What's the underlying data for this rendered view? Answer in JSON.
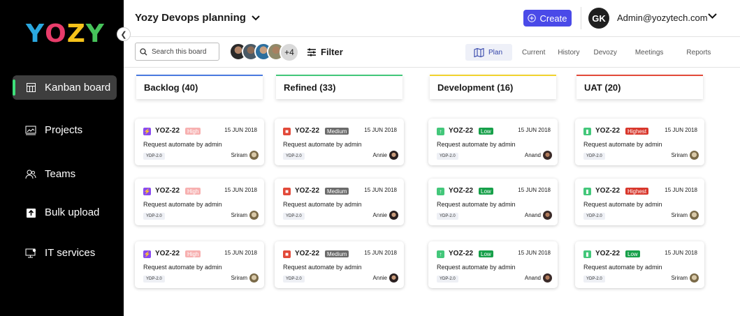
{
  "colors": {
    "accent": "#4a4ae8",
    "active_indicator": "#3ee07a"
  },
  "logo": {
    "letters": [
      {
        "ch": "Y",
        "color": "#2aa8e0"
      },
      {
        "ch": "O",
        "color": "#e83c6a"
      },
      {
        "ch": "Z",
        "color": "#f5c21a"
      },
      {
        "ch": "Y",
        "color": "#46c35a"
      }
    ]
  },
  "sidebar": {
    "items": [
      {
        "label": "Kanban board",
        "icon": "kanban-icon",
        "active": true
      },
      {
        "label": "Projects",
        "icon": "projects-icon"
      },
      {
        "label": "Teams",
        "icon": "teams-icon"
      },
      {
        "label": "Bulk upload",
        "icon": "upload-icon"
      },
      {
        "label": "IT services",
        "icon": "it-services-icon"
      }
    ]
  },
  "header": {
    "board_title": "Yozy Devops planning",
    "create_label": "Create",
    "user_initials": "GK",
    "user_email": "Admin@yozytech.com"
  },
  "toolbar": {
    "search_placeholder": "Search this board",
    "more_members": "+4",
    "filter_label": "Filter",
    "tabs": [
      "Plan",
      "Current",
      "History",
      "Devozy",
      "Meetings",
      "Reports"
    ]
  },
  "columns": [
    {
      "title": "Backlog (40)",
      "color": "#4a7ae0"
    },
    {
      "title": "Refined (33)",
      "color": "#43c77a"
    },
    {
      "title": "Development (16)",
      "color": "#f1d32e"
    },
    {
      "title": "UAT (20)",
      "color": "#e24a3a"
    }
  ],
  "cards": [
    [
      {
        "key": "YOZ-22",
        "priority": "High",
        "date": "15 JUN 2018",
        "title": "Request automate by admin",
        "tag": "YDP-2.0",
        "assignee": "Sriram"
      },
      {
        "key": "YOZ-22",
        "priority": "High",
        "date": "15 JUN 2018",
        "title": "Request automate by admin",
        "tag": "YDP-2.0",
        "assignee": "Sriram"
      },
      {
        "key": "YOZ-22",
        "priority": "High",
        "date": "15 JUN 2018",
        "title": "Request automate by admin",
        "tag": "YDP-2.0",
        "assignee": "Sriram"
      }
    ],
    [
      {
        "key": "YOZ-22",
        "priority": "Medium",
        "date": "15 JUN 2018",
        "title": "Request automate by admin",
        "tag": "YDP-2.0",
        "assignee": "Annie"
      },
      {
        "key": "YOZ-22",
        "priority": "Medium",
        "date": "15 JUN 2018",
        "title": "Request automate by admin",
        "tag": "YDP-2.0",
        "assignee": "Annie"
      },
      {
        "key": "YOZ-22",
        "priority": "Medium",
        "date": "15 JUN 2018",
        "title": "Request automate by admin",
        "tag": "YDP-2.0",
        "assignee": "Annie"
      }
    ],
    [
      {
        "key": "YOZ-22",
        "priority": "Low",
        "date": "15 JUN 2018",
        "title": "Request automate by admin",
        "tag": "YDP-2.0",
        "assignee": "Anand"
      },
      {
        "key": "YOZ-22",
        "priority": "Low",
        "date": "15 JUN 2018",
        "title": "Request automate by admin",
        "tag": "YDP-2.0",
        "assignee": "Anand"
      },
      {
        "key": "YOZ-22",
        "priority": "Low",
        "date": "15 JUN 2018",
        "title": "Request automate by admin",
        "tag": "YDP-2.0",
        "assignee": "Anand"
      }
    ],
    [
      {
        "key": "YOZ-22",
        "priority": "Highest",
        "date": "15 JUN 2018",
        "title": "Request automate by admin",
        "tag": "YDP-2.0",
        "assignee": "Sriram"
      },
      {
        "key": "YOZ-22",
        "priority": "Highest",
        "date": "15 JUN 2018",
        "title": "Request automate by admin",
        "tag": "YDP-2.0",
        "assignee": "Sriram"
      },
      {
        "key": "YOZ-22",
        "priority": "Low",
        "date": "15 JUN 2018",
        "title": "Request automate by admin",
        "tag": "YDP-2.0",
        "assignee": "Sriram"
      }
    ]
  ]
}
